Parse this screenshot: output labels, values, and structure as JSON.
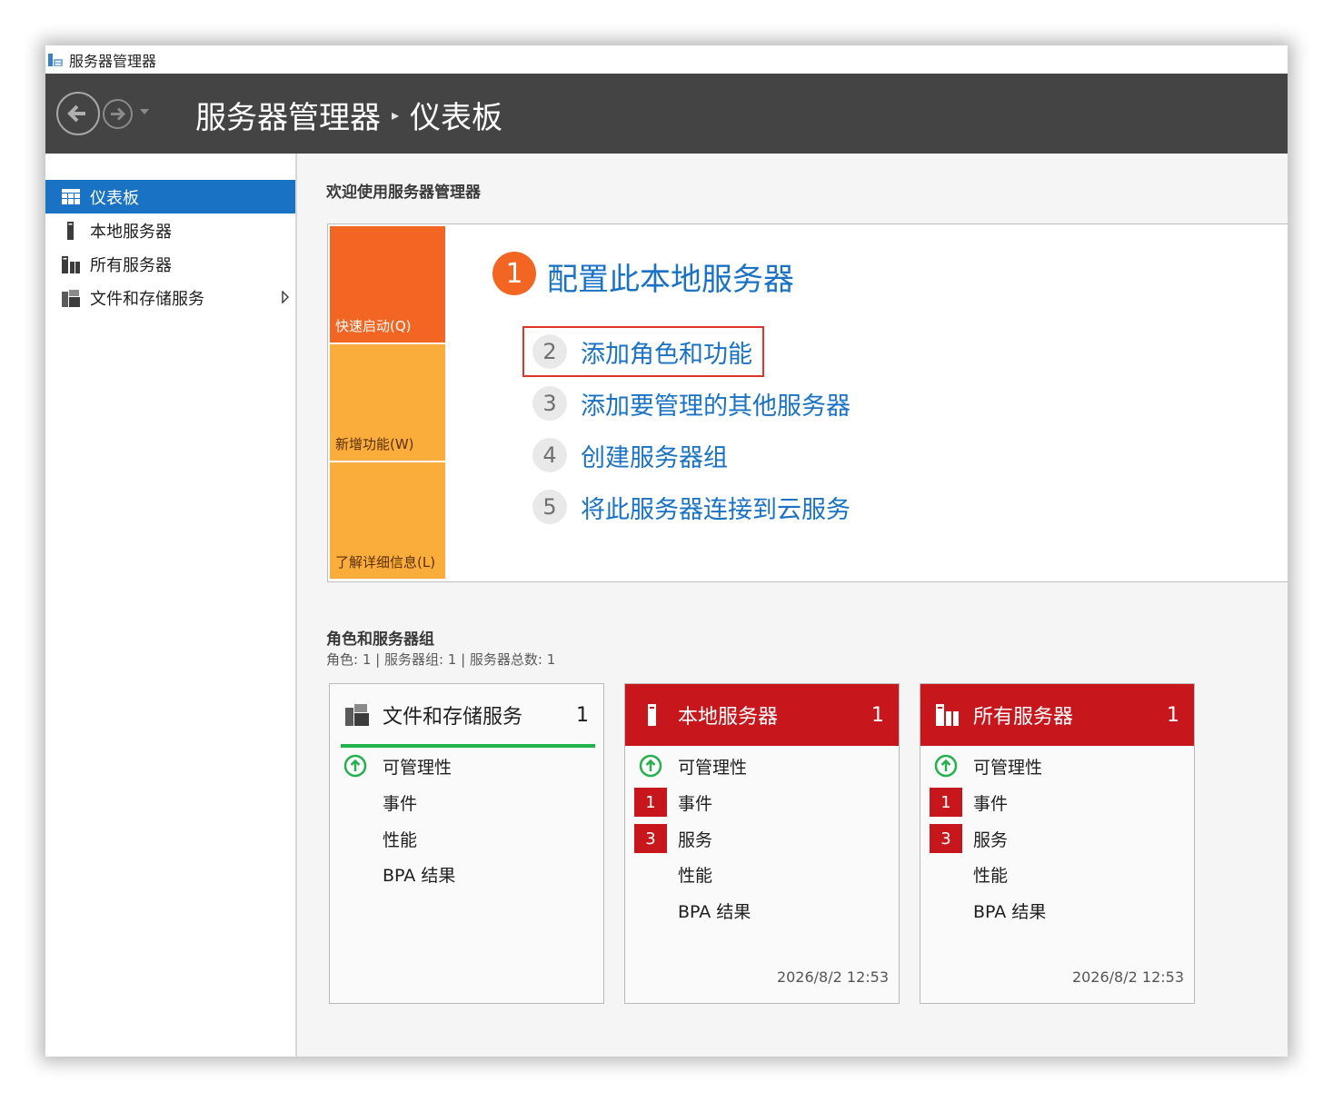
{
  "window": {
    "title": "服务器管理器"
  },
  "header": {
    "crumb_root": "服务器管理器",
    "crumb_current": "仪表板"
  },
  "sidebar": {
    "items": [
      {
        "label": "仪表板",
        "icon": "dashboard-icon",
        "active": true
      },
      {
        "label": "本地服务器",
        "icon": "local-server-icon"
      },
      {
        "label": "所有服务器",
        "icon": "all-servers-icon"
      },
      {
        "label": "文件和存储服务",
        "icon": "file-storage-icon",
        "expandable": true
      }
    ]
  },
  "welcome": {
    "heading": "欢迎使用服务器管理器",
    "tiles": {
      "quick_start": "快速启动(Q)",
      "whats_new": "新增功能(W)",
      "learn_more": "了解详细信息(L)"
    },
    "step1": {
      "num": "1",
      "label": "配置此本地服务器"
    },
    "steps": [
      {
        "num": "2",
        "label": "添加角色和功能"
      },
      {
        "num": "3",
        "label": "添加要管理的其他服务器"
      },
      {
        "num": "4",
        "label": "创建服务器组"
      },
      {
        "num": "5",
        "label": "将此服务器连接到云服务"
      }
    ]
  },
  "roles": {
    "title": "角色和服务器组",
    "summary": "角色: 1 | 服务器组: 1 | 服务器总数: 1",
    "cards": [
      {
        "title": "文件和存储服务",
        "count": "1",
        "rows": [
          "可管理性",
          "事件",
          "性能",
          "BPA 结果"
        ]
      },
      {
        "title": "本地服务器",
        "count": "1",
        "rows": [
          "可管理性",
          "事件",
          "服务",
          "性能",
          "BPA 结果"
        ],
        "badges": {
          "events": "1",
          "services": "3"
        },
        "timestamp": "2026/8/2 12:53"
      },
      {
        "title": "所有服务器",
        "count": "1",
        "rows": [
          "可管理性",
          "事件",
          "服务",
          "性能",
          "BPA 结果"
        ],
        "badges": {
          "events": "1",
          "services": "3"
        },
        "timestamp": "2026/8/2 12:53"
      }
    ]
  },
  "colors": {
    "header_bg": "#444444",
    "accent_blue": "#1a72c4",
    "quick_start_orange": "#f26522",
    "tile_yellow": "#fbad3c",
    "alert_red": "#c8161d",
    "ok_green": "#22b24c"
  }
}
